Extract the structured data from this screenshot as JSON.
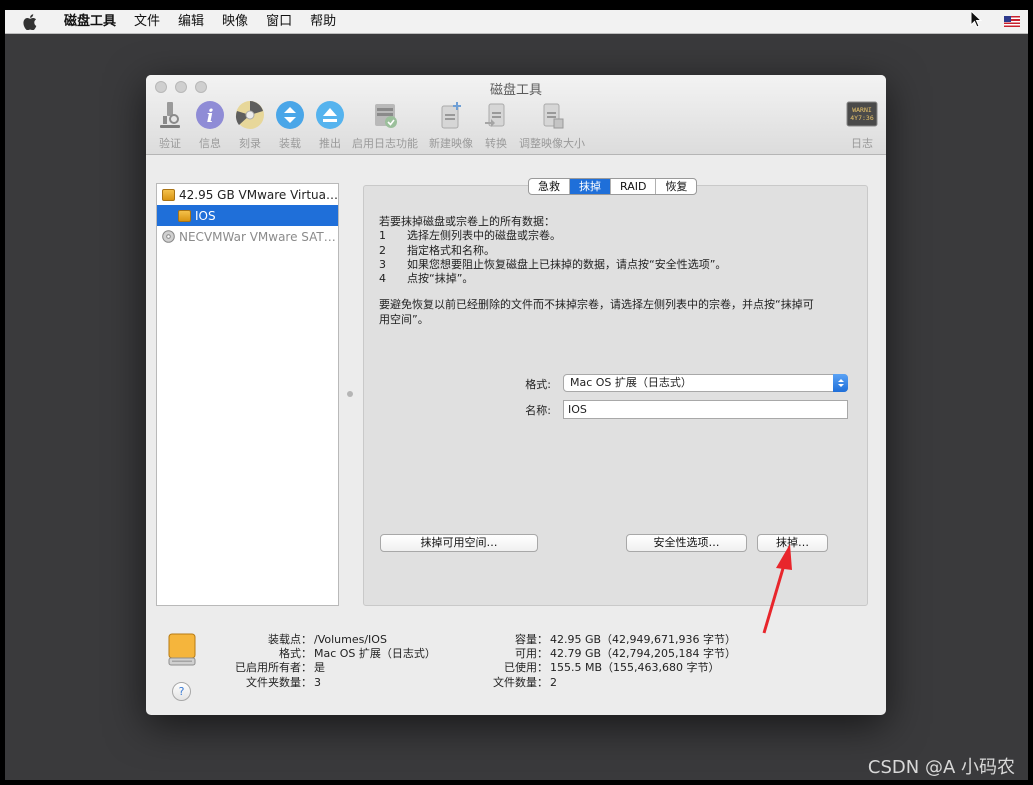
{
  "menubar": {
    "items": [
      "磁盘工具",
      "文件",
      "编辑",
      "映像",
      "窗口",
      "帮助"
    ]
  },
  "window": {
    "title": "磁盘工具",
    "toolbar": [
      {
        "label": "验证",
        "icon": "microscope-icon"
      },
      {
        "label": "信息",
        "icon": "info-icon"
      },
      {
        "label": "刻录",
        "icon": "burn-disc-icon"
      },
      {
        "label": "装载",
        "icon": "mount-icon"
      },
      {
        "label": "推出",
        "icon": "eject-icon"
      },
      {
        "label": "启用日志功能",
        "icon": "enable-journaling-icon"
      },
      {
        "label": "新建映像",
        "icon": "new-image-icon"
      },
      {
        "label": "转换",
        "icon": "convert-icon"
      },
      {
        "label": "调整映像大小",
        "icon": "resize-image-icon"
      },
      {
        "label": "日志",
        "icon": "log-icon"
      }
    ],
    "log_icon_text": [
      "WARNI",
      "4Y7:36"
    ]
  },
  "sidebar": {
    "items": [
      {
        "label": "42.95 GB VMware Virtua…",
        "icon": "hard-disk-icon"
      },
      {
        "label": "IOS",
        "icon": "volume-icon",
        "selected": true
      },
      {
        "label": "NECVMWar VMware SAT…",
        "icon": "optical-drive-icon"
      }
    ]
  },
  "tabs": [
    {
      "label": "急救",
      "active": false
    },
    {
      "label": "抹掉",
      "active": true
    },
    {
      "label": "RAID",
      "active": false
    },
    {
      "label": "恢复",
      "active": false
    }
  ],
  "erase": {
    "intro": "若要抹掉磁盘或宗卷上的所有数据：",
    "steps": [
      {
        "n": "1",
        "text": "选择左侧列表中的磁盘或宗卷。"
      },
      {
        "n": "2",
        "text": "指定格式和名称。"
      },
      {
        "n": "3",
        "text": "如果您想要阻止恢复磁盘上已抹掉的数据，请点按“安全性选项”。"
      },
      {
        "n": "4",
        "text": "点按“抹掉”。"
      }
    ],
    "note_line1": "要避免恢复以前已经删除的文件而不抹掉宗卷，请选择左侧列表中的宗卷，并点按“抹掉可",
    "note_line2": "用空间”。",
    "format_label": "格式:",
    "format_value": "Mac OS 扩展（日志式）",
    "name_label": "名称:",
    "name_value": "IOS",
    "erase_free_space_button": "抹掉可用空间…",
    "security_options_button": "安全性选项…",
    "erase_button": "抹掉…"
  },
  "info": {
    "left": [
      {
        "k": "装载点：",
        "v": "/Volumes/IOS"
      },
      {
        "k": "格式：",
        "v": "Mac OS 扩展（日志式）"
      },
      {
        "k": "已启用所有者：",
        "v": "是"
      },
      {
        "k": "文件夹数量：",
        "v": "3"
      }
    ],
    "right": [
      {
        "k": "容量：",
        "v": "42.95 GB（42,949,671,936 字节）"
      },
      {
        "k": "可用：",
        "v": "42.79 GB（42,794,205,184 字节）"
      },
      {
        "k": "已使用：",
        "v": "155.5 MB（155,463,680 字节）"
      },
      {
        "k": "文件数量：",
        "v": "2"
      }
    ],
    "help": "?"
  },
  "watermark": "CSDN @A 小码农",
  "colors": {
    "accent": "#1f6fd9",
    "annotation_arrow": "#e8262c",
    "disk_orange": "#f0a32a"
  }
}
